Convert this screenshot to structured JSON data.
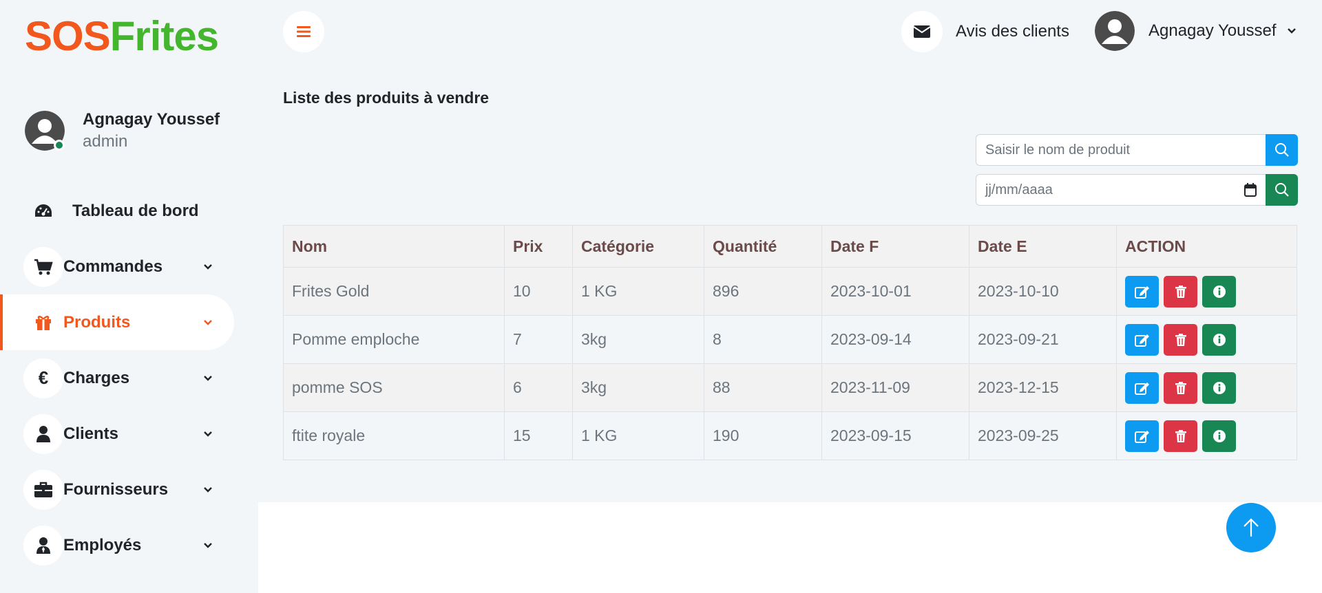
{
  "brand": {
    "part1": "SOS",
    "part2": "Frites"
  },
  "profile": {
    "name": "Agnagay Youssef",
    "role": "admin"
  },
  "nav": {
    "dashboard": "Tableau de bord",
    "orders": "Commandes",
    "products": "Produits",
    "charges": "Charges",
    "clients": "Clients",
    "suppliers": "Fournisseurs",
    "employees": "Employés"
  },
  "header": {
    "reviews_label": "Avis des clients",
    "user_name": "Agnagay Youssef"
  },
  "page": {
    "title": "Liste des produits à vendre"
  },
  "search": {
    "product_placeholder": "Saisir le nom de produit",
    "date_placeholder": "jj/mm/aaaa"
  },
  "table": {
    "headers": {
      "name": "Nom",
      "price": "Prix",
      "category": "Catégorie",
      "quantity": "Quantité",
      "date_f": "Date F",
      "date_e": "Date E",
      "action": "ACTION"
    },
    "rows": [
      {
        "name": "Frites Gold",
        "price": "10",
        "category": "1 KG",
        "quantity": "896",
        "date_f": "2023-10-01",
        "date_e": "2023-10-10"
      },
      {
        "name": "Pomme emploche",
        "price": "7",
        "category": "3kg",
        "quantity": "8",
        "date_f": "2023-09-14",
        "date_e": "2023-09-21"
      },
      {
        "name": "pomme SOS",
        "price": "6",
        "category": "3kg",
        "quantity": "88",
        "date_f": "2023-11-09",
        "date_e": "2023-12-15"
      },
      {
        "name": "ftite royale",
        "price": "15",
        "category": "1 KG",
        "quantity": "190",
        "date_f": "2023-09-15",
        "date_e": "2023-09-25"
      }
    ]
  },
  "colors": {
    "brand_orange": "#f2581d",
    "brand_green": "#43b62d",
    "primary": "#0d9bf2",
    "danger": "#dc3545",
    "success": "#198754"
  },
  "icons": [
    "bars-icon",
    "envelope-icon",
    "user-avatar-icon",
    "chevron-down-icon",
    "dashboard-icon",
    "cart-icon",
    "gift-icon",
    "euro-icon",
    "user-icon",
    "briefcase-icon",
    "employee-icon",
    "search-icon",
    "calendar-icon",
    "edit-icon",
    "trash-icon",
    "info-icon",
    "arrow-up-icon"
  ]
}
